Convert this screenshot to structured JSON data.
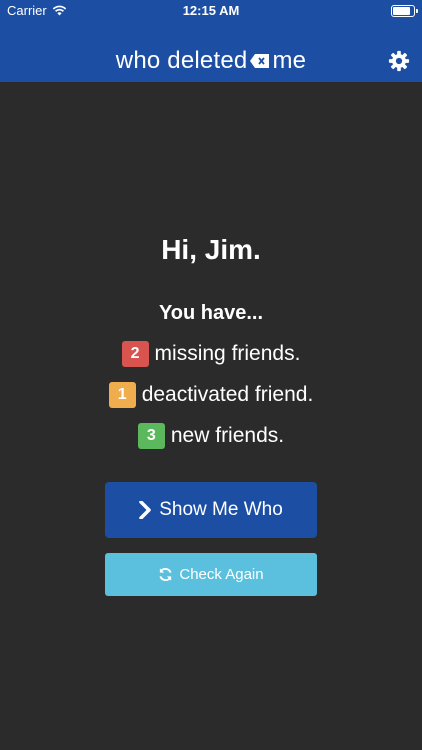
{
  "statusbar": {
    "carrier": "Carrier",
    "time": "12:15 AM",
    "battery_level": 0.85
  },
  "navbar": {
    "logo_part1": "who deleted",
    "logo_part2": "me",
    "settings_icon": "gear-icon"
  },
  "main": {
    "greeting": "Hi, Jim.",
    "you_have": "You have...",
    "stats": [
      {
        "count": "2",
        "label": "missing friends.",
        "color": "#d9534f"
      },
      {
        "count": "1",
        "label": "deactivated friend.",
        "color": "#f0ad4e"
      },
      {
        "count": "3",
        "label": "new friends.",
        "color": "#5cb85c"
      }
    ],
    "primary_button": "Show Me Who",
    "secondary_button": "Check Again"
  }
}
